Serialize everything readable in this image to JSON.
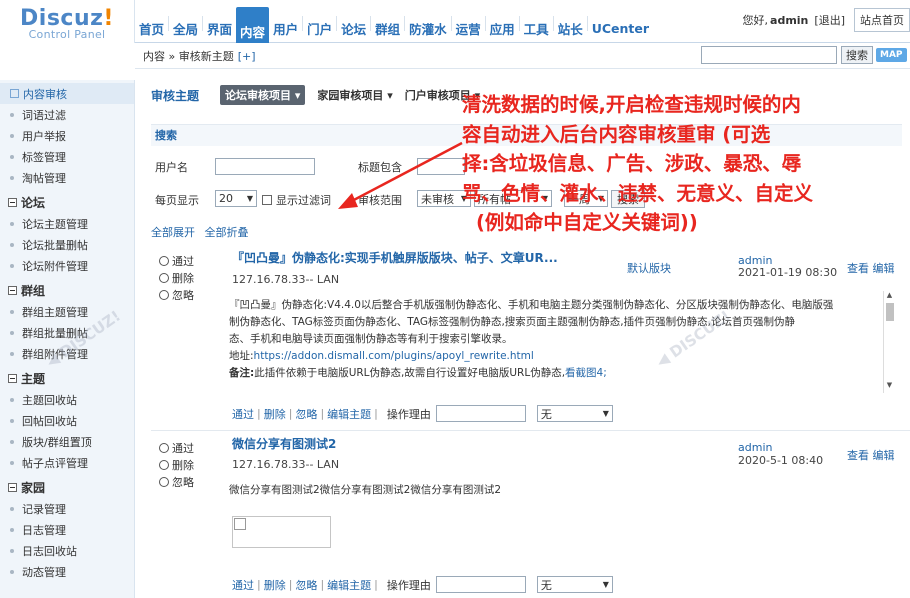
{
  "header": {
    "logo_main": "Discuz",
    "logo_bang": "!",
    "logo_sub": "Control Panel",
    "nav": [
      "首页",
      "全局",
      "界面",
      "内容",
      "用户",
      "门户",
      "论坛",
      "群组",
      "防灌水",
      "运营",
      "应用",
      "工具",
      "站长",
      "UCenter"
    ],
    "user_greeting": "您好,",
    "user_name": "admin",
    "logout": "[退出]",
    "home_button": "站点首页"
  },
  "crumb": {
    "path": "内容 » 审核新主题",
    "add": "[+]",
    "search_button": "搜索",
    "map_button": "MAP"
  },
  "sidebar": {
    "groups": [
      {
        "items": [
          "内容审核",
          "词语过滤",
          "用户举报",
          "标签管理",
          "淘帖管理"
        ]
      },
      {
        "head": "论坛",
        "items": [
          "论坛主题管理",
          "论坛批量删帖",
          "论坛附件管理"
        ]
      },
      {
        "head": "群组",
        "items": [
          "群组主题管理",
          "群组批量删帖",
          "群组附件管理"
        ]
      },
      {
        "head": "主题",
        "items": [
          "主题回收站",
          "回帖回收站",
          "版块/群组置顶",
          "帖子点评管理"
        ]
      },
      {
        "head": "家园",
        "items": [
          "记录管理",
          "日志管理",
          "日志回收站",
          "动态管理"
        ]
      }
    ]
  },
  "main": {
    "title": "审核主题",
    "tabs": [
      "论坛审核项目",
      "家园审核项目",
      "门户审核项目"
    ],
    "search_header": "搜索",
    "username_label": "用户名",
    "title_contains_label": "标题包含",
    "per_page_label": "每页显示",
    "per_page_value": "20",
    "show_filtered_label": "显示过滤词",
    "audit_scope_label": "审核范围",
    "scope_value": "未审核",
    "forum_value": "所有帖",
    "time_value": "一周",
    "search_button": "搜索",
    "expand_all": "全部展开",
    "collapse_all": "全部折叠",
    "radio_pass": "通过",
    "radio_delete": "删除",
    "radio_ignore": "忽略",
    "act_pass": "通过",
    "act_delete": "删除",
    "act_ignore": "忽略",
    "act_edit": "编辑主题",
    "act_reason": "操作理由",
    "act_select": "无",
    "view": "查看",
    "edit": "编辑"
  },
  "posts": [
    {
      "title": "『凹凸曼』伪静态化:实现手机触屏版版块、帖子、文章UR...",
      "ip": "127.16.78.33-- LAN",
      "forum": "默认版块",
      "author": "admin",
      "date": "2021-01-19 08:30",
      "body_lines": [
        "『凹凸曼』伪静态化:V4.4.0以后整合手机版强制伪静态化、手机和电脑主题分类强制伪静态化、分区版块强制伪静态化、电脑版强",
        "制伪静态化、TAG标签页面伪静态化、TAG标签强制伪静态,搜索页面主题强制伪静态,插件页强制伪静态,论坛首页强制伪静",
        "态、手机和电脑导读页面强制伪静态等有利于搜索引擎收录。"
      ],
      "address_label": "地址:",
      "address": "https://addon.dismall.com/plugins/apoyl_rewrite.html",
      "note_label": "备注:",
      "note": "此插件依赖于电脑版URL伪静态,故需自行设置好电脑版URL伪静态,",
      "note_link": "看截图4;"
    },
    {
      "title": "微信分享有图测试2",
      "ip": "127.16.78.33-- LAN",
      "author": "admin",
      "date": "2020-5-1 08:40",
      "body": "微信分享有图测试2微信分享有图测试2微信分享有图测试2"
    }
  ],
  "annotation": {
    "lines": [
      "清洗数据的时候,开启检查违规时候的内",
      "容自动进入后台内容审核重审 (可选",
      "择:含垃圾信息、广告、涉政、暴恐、辱",
      "骂、色情、灌水、违禁、无意义、自定义",
      "(例如命中自定义关键词))"
    ],
    "color": "#e8261f"
  },
  "colors": {
    "accent": "#2f7fc8",
    "link": "#2366a8",
    "sidebar_bg": "#f0f5fa"
  }
}
